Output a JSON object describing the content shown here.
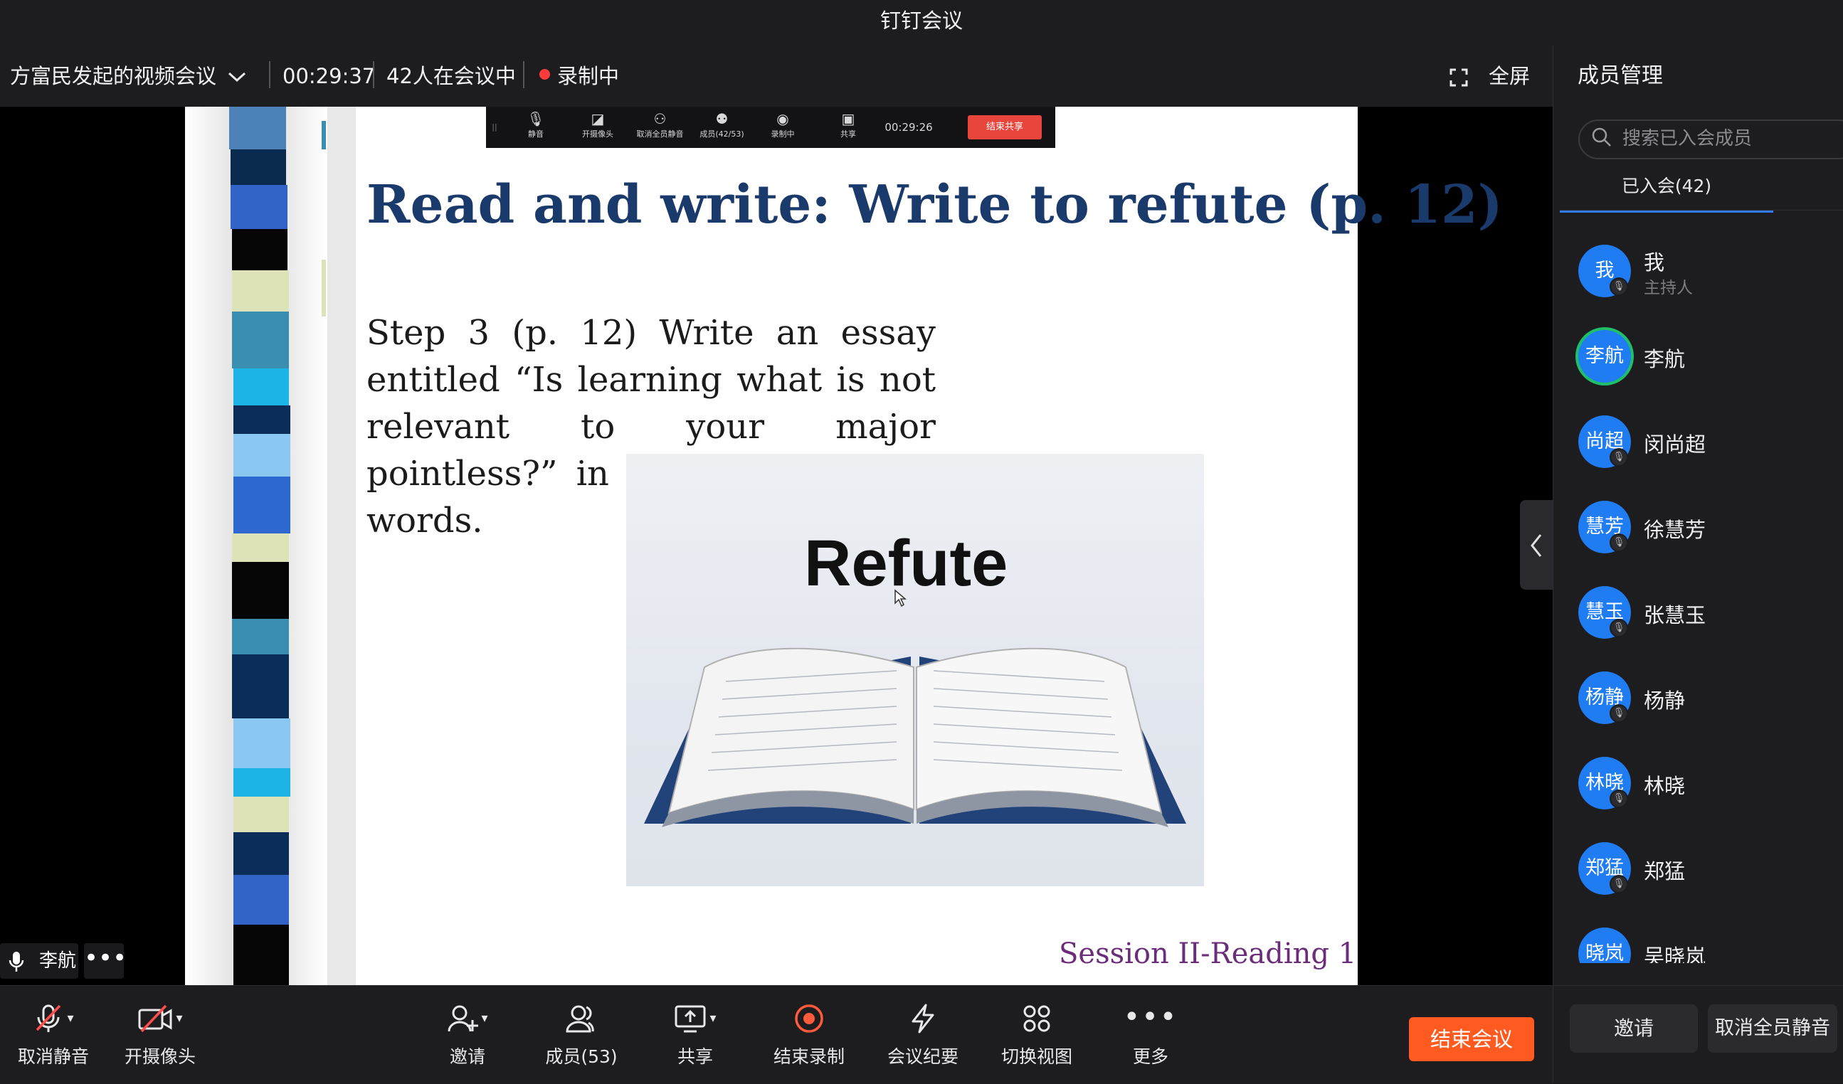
{
  "app": {
    "title": "钉钉会议"
  },
  "meeting": {
    "name": "方富民发起的视频会议",
    "duration": "00:29:37",
    "participants_status": "42人在会议中",
    "recording_status": "录制中",
    "fullscreen_label": "全屏"
  },
  "shared_toolbar": {
    "mute": "静音",
    "camera": "开摄像头",
    "mute_all": "取消全员静音",
    "members": "成员(42/53)",
    "record": "录制中",
    "share": "共享",
    "time": "00:29:26",
    "end_share": "结束共享"
  },
  "slide": {
    "title": "Read and write: Write to refute (p. 12)",
    "body": "Step 3 (p. 12) Write an essay entitled “Is learning what is not relevant to your major pointless?” in no less than 150 words.",
    "image_word": "Refute",
    "footer": "Session II-Reading 1"
  },
  "stage": {
    "speaker": "李航"
  },
  "toolbar": {
    "unmute": "取消静音",
    "camera": "开摄像头",
    "invite": "邀请",
    "members": "成员(53)",
    "share": "共享",
    "end_recording": "结束录制",
    "minutes": "会议纪要",
    "switch_view": "切换视图",
    "more": "更多",
    "end_meeting": "结束会议"
  },
  "panel": {
    "title": "成员管理",
    "search_placeholder": "搜索已入会成员",
    "tab_joined": "已入会(42)",
    "members": [
      {
        "avatar": "我",
        "name": "我",
        "role": "主持人"
      },
      {
        "avatar": "李航",
        "name": "李航"
      },
      {
        "avatar": "尚超",
        "name": "闵尚超"
      },
      {
        "avatar": "慧芳",
        "name": "徐慧芳"
      },
      {
        "avatar": "慧玉",
        "name": "张慧玉"
      },
      {
        "avatar": "杨静",
        "name": "杨静"
      },
      {
        "avatar": "林晓",
        "name": "林晓"
      },
      {
        "avatar": "郑猛",
        "name": "郑猛"
      },
      {
        "avatar": "晓岚",
        "name": "吴晓岚"
      }
    ],
    "invite_button": "邀请",
    "unmute_all_button": "取消全员静音"
  },
  "colors": {
    "accent": "#2f7cf6",
    "end_meeting": "#ff5a1f",
    "avatar": "#1f7cf3",
    "slide_title": "#1a3a6b",
    "slide_footer": "#6b2c7a"
  }
}
